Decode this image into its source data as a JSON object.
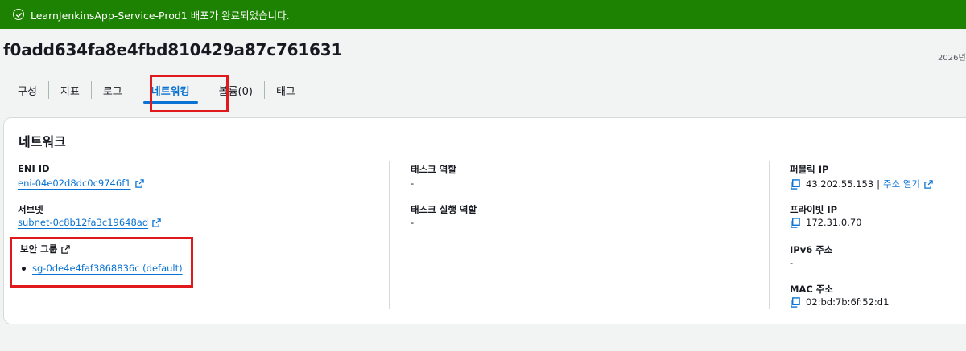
{
  "banner": {
    "message": "LearnJenkinsApp-Service-Prod1 배포가 완료되었습니다.",
    "color": "#1d8102"
  },
  "task": {
    "id": "f0add634fa8e4fbd810429a87c761631",
    "date_partial": "2026년"
  },
  "tabs": [
    {
      "label": "구성"
    },
    {
      "label": "지표"
    },
    {
      "label": "로그"
    },
    {
      "label": "네트워킹"
    },
    {
      "label": "볼륨(0)"
    },
    {
      "label": "태그"
    }
  ],
  "active_tab": "네트워킹",
  "network": {
    "title": "네트워크",
    "eni": {
      "label": "ENI ID",
      "value": "eni-04e02d8dc0c9746f1"
    },
    "subnet": {
      "label": "서브넷",
      "value": "subnet-0c8b12fa3c19648ad"
    },
    "security_group": {
      "label": "보안 그룹",
      "items": [
        "sg-0de4e4faf3868836c (default)"
      ]
    },
    "task_role": {
      "label": "태스크 역할",
      "value": "-"
    },
    "task_exec_role": {
      "label": "태스크 실행 역할",
      "value": "-"
    },
    "public_ip": {
      "label": "퍼블릭 IP",
      "value": "43.202.55.153",
      "separator": "|",
      "open_link": "주소 열기"
    },
    "private_ip": {
      "label": "프라이빗 IP",
      "value": "172.31.0.70"
    },
    "ipv6": {
      "label": "IPv6 주소",
      "value": "-"
    },
    "mac": {
      "label": "MAC 주소",
      "value": "02:bd:7b:6f:52:d1"
    }
  },
  "colors": {
    "link": "#0972d3",
    "highlight": "#e0191c"
  },
  "icons": [
    "check-circle-icon",
    "external-link-icon",
    "copy-icon"
  ]
}
